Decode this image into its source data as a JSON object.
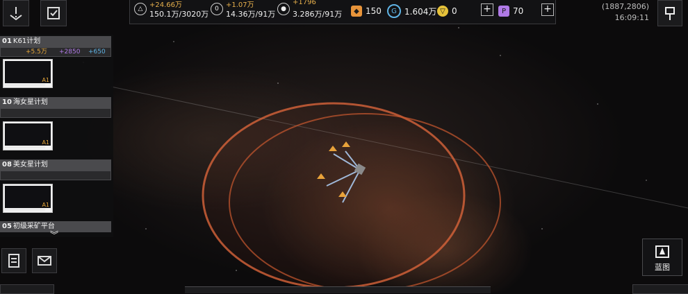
{
  "resources": [
    {
      "icon": "metal-icon",
      "symbol": "△",
      "increment": "+24.66万",
      "amount": "150.1万/3020万"
    },
    {
      "icon": "crystal-icon",
      "symbol": "0",
      "increment": "+1.07万",
      "amount": "14.36万/91万"
    },
    {
      "icon": "gas-icon",
      "symbol": "●",
      "increment": "+1796",
      "amount": "3.286万/91万"
    }
  ],
  "currencies": [
    {
      "icon": "orange-credit-icon",
      "value": "150",
      "color": "#e8943a"
    },
    {
      "icon": "blue-token-icon",
      "value": "1.604万",
      "color": "#5fb4e6"
    },
    {
      "icon": "gold-token-icon",
      "value": "0",
      "color": "#e6c23a"
    },
    {
      "icon": "purple-token-icon",
      "value": "70",
      "color": "#b07ae6"
    }
  ],
  "coordinates": "(1887,2806)",
  "time": "16:09:11",
  "fleets": [
    {
      "number": "01",
      "name": "K61计划",
      "stats": {
        "a": "+5.5万",
        "b": "+2850",
        "c": "+650"
      },
      "level": "A1"
    },
    {
      "number": "10",
      "name": "海女星计划",
      "level": "A1"
    },
    {
      "number": "08",
      "name": "美女星计划",
      "level": "A1"
    },
    {
      "number": "05",
      "name": "初级采矿平台"
    }
  ],
  "blueprint_label": "蓝图",
  "colors": {
    "accent": "#e7a83a",
    "ring": "#e0663a"
  }
}
